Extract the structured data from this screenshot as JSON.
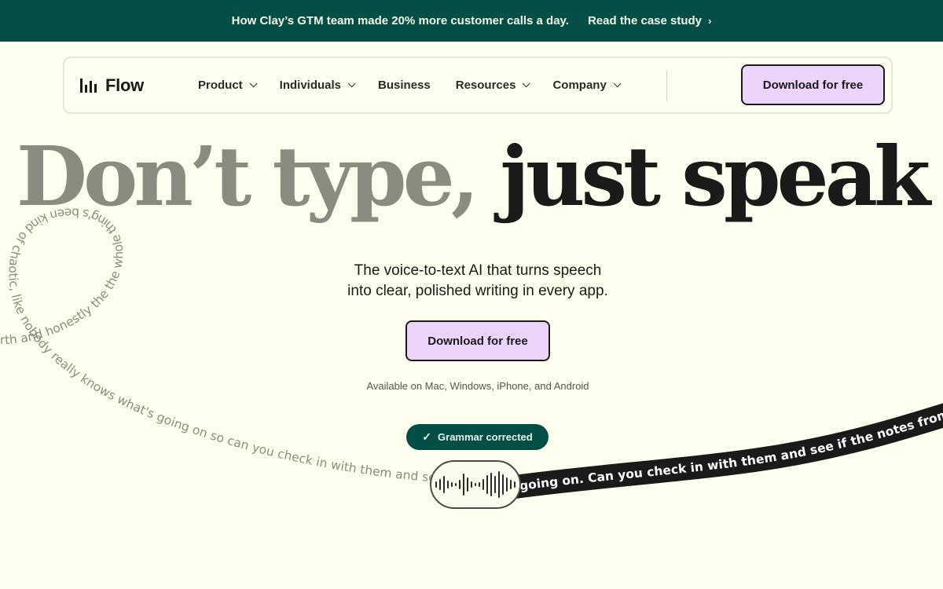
{
  "banner": {
    "text": "How Clay’s GTM team made 20% more customer calls a day.",
    "link": "Read the case study",
    "chevron": "›"
  },
  "nav": {
    "logo_text": "Flow",
    "items": [
      {
        "label": "Product",
        "has_dropdown": true
      },
      {
        "label": "Individuals",
        "has_dropdown": true
      },
      {
        "label": "Business",
        "has_dropdown": false
      },
      {
        "label": "Resources",
        "has_dropdown": true
      },
      {
        "label": "Company",
        "has_dropdown": true
      }
    ],
    "cta": "Download for free"
  },
  "hero": {
    "title_part1": "Don’t type, ",
    "title_part2": "just speak",
    "subtitle_line1": "The voice-to-text AI that turns speech",
    "subtitle_line2": "into clear, polished writing in every app.",
    "cta": "Download for free",
    "availability": "Available on Mac, Windows, iPhone, and Android"
  },
  "badge": {
    "icon": "checkmark-icon",
    "label": "Grammar corrected"
  },
  "speech": {
    "raw_text": "rth and honestly the the whole thing's been kind of chaotic, like nobody really knows what's going on so can you check in with them and see",
    "polished_text": "going on. Can you check in with them and see if the notes from yes"
  },
  "colors": {
    "banner_bg": "#034f46",
    "page_bg": "#fffff0",
    "cta_bg": "#ecd5fb",
    "muted_title": "#8c8b80",
    "ribbon": "#1a1a1a"
  }
}
